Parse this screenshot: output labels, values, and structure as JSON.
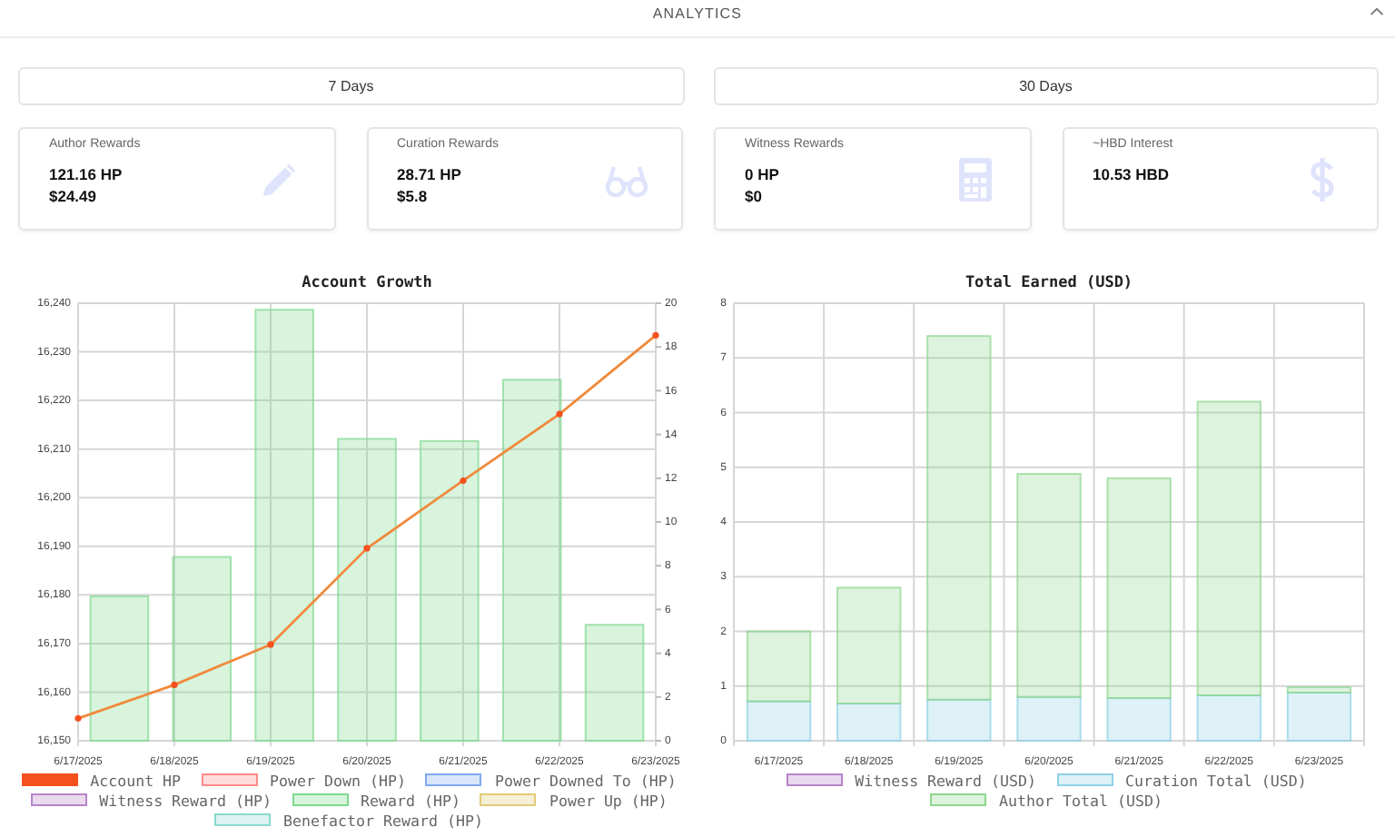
{
  "header": {
    "title": "ANALYTICS",
    "expanded": true
  },
  "periods": [
    {
      "label": "7 Days"
    },
    {
      "label": "30 Days"
    }
  ],
  "cards": [
    {
      "title": "Author Rewards",
      "lines": [
        "121.16 HP",
        "$24.49"
      ],
      "kind": "pencil"
    },
    {
      "title": "Curation Rewards",
      "lines": [
        "28.71 HP",
        "$5.8"
      ],
      "kind": "glasses"
    },
    {
      "title": "Witness Rewards",
      "lines": [
        "0 HP",
        "$0"
      ],
      "kind": "calculator"
    },
    {
      "title": "~HBD Interest",
      "lines": [
        "10.53 HBD"
      ],
      "kind": "dollar"
    }
  ],
  "charts": [
    {
      "chart_data": {
        "type": "bar",
        "title": "Account Growth",
        "categories": [
          "6/17/2025",
          "6/18/2025",
          "6/19/2025",
          "6/20/2025",
          "6/21/2025",
          "6/22/2025",
          "6/23/2025"
        ],
        "ylim": [
          16150,
          16240
        ],
        "yticks": [
          {
            "value": 16150,
            "label": "16,150"
          },
          {
            "value": 16160,
            "label": "16,160"
          },
          {
            "value": 16170,
            "label": "16,170"
          },
          {
            "value": 16180,
            "label": "16,180"
          },
          {
            "value": 16190,
            "label": "16,190"
          },
          {
            "value": 16200,
            "label": "16,200"
          },
          {
            "value": 16210,
            "label": "16,210"
          },
          {
            "value": 16220,
            "label": "16,220"
          },
          {
            "value": 16230,
            "label": "16,230"
          },
          {
            "value": 16240,
            "label": "16,240"
          }
        ],
        "grid": true,
        "legend": "bottom",
        "y2lim": [
          0,
          20
        ],
        "y2ticks": [
          0,
          2,
          4,
          6,
          8,
          10,
          12,
          14,
          16,
          18,
          20
        ],
        "series": [
          {
            "name": "Account HP",
            "type": "line",
            "marker": true,
            "color": "#f4511e",
            "values": [
              16154.6,
              16161.5,
              16169.8,
              16189.6,
              16203.5,
              16217.2,
              16233.4
            ]
          },
          {
            "name": "Power Down (HP)",
            "type": "bar",
            "axis": "y2",
            "color": "#ff8a8a",
            "values": [
              null,
              null,
              null,
              null,
              null,
              null,
              null
            ]
          },
          {
            "name": "Power Downed To (HP)",
            "type": "bar",
            "axis": "y2",
            "color": "#7fa8f0",
            "values": [
              null,
              null,
              null,
              null,
              null,
              null,
              null
            ]
          },
          {
            "name": "Witness Reward (HP)",
            "type": "bar",
            "axis": "y2",
            "color": "#b784c8",
            "values": [
              null,
              null,
              null,
              null,
              null,
              null,
              null
            ]
          },
          {
            "name": "Reward (HP)",
            "type": "bar",
            "axis": "y2",
            "color": "#7fd98f",
            "values": [
              6.6,
              8.4,
              19.7,
              13.8,
              13.7,
              16.5,
              5.3
            ]
          },
          {
            "name": "Power Up (HP)",
            "type": "bar",
            "axis": "y2",
            "color": "#e0cb7a",
            "values": [
              null,
              null,
              null,
              null,
              null,
              null,
              null
            ]
          },
          {
            "name": "Benefactor Reward (HP)",
            "type": "bar",
            "axis": "y2",
            "color": "#8ad8d0",
            "values": [
              null,
              null,
              null,
              null,
              null,
              null,
              null
            ]
          }
        ]
      }
    },
    {
      "chart_data": {
        "type": "bar",
        "title": "Total Earned (USD)",
        "categories": [
          "6/17/2025",
          "6/18/2025",
          "6/19/2025",
          "6/20/2025",
          "6/21/2025",
          "6/22/2025",
          "6/23/2025"
        ],
        "ylim": [
          0,
          8
        ],
        "yticks": [
          0,
          1,
          2,
          3,
          4,
          5,
          6,
          7,
          8
        ],
        "stacked": true,
        "grid": true,
        "legend": "bottom",
        "series": [
          {
            "name": "Witness Reward (USD)",
            "color": "#b784c8",
            "values": [
              0,
              0,
              0,
              0,
              0,
              0,
              0
            ]
          },
          {
            "name": "Curation Total (USD)",
            "color": "#8fd0e6",
            "values": [
              0.72,
              0.68,
              0.75,
              0.8,
              0.78,
              0.83,
              0.88
            ]
          },
          {
            "name": "Author Total (USD)",
            "color": "#8fd68f",
            "values": [
              1.28,
              2.12,
              6.65,
              4.08,
              4.02,
              5.37,
              0.1
            ]
          }
        ]
      }
    }
  ]
}
